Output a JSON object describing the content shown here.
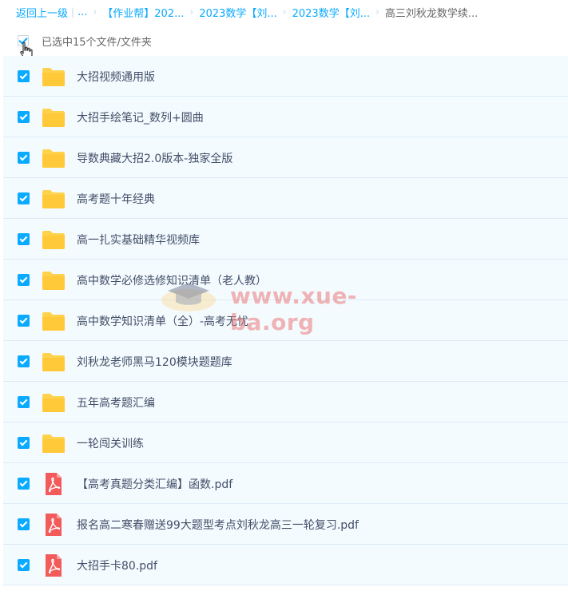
{
  "breadcrumb": {
    "back_label": "返回上一级",
    "ellipsis": "...",
    "crumbs": [
      "【作业帮】202...",
      "2023数学【刘...",
      "2023数学【刘..."
    ],
    "current": "高三刘秋龙数学续..."
  },
  "selection": {
    "label": "已选中15个文件/文件夹"
  },
  "files": [
    {
      "name": "大招视频通用版",
      "icon": "folder-icon",
      "checked": true
    },
    {
      "name": "大招手绘笔记_数列+圆曲",
      "icon": "folder-icon",
      "checked": true
    },
    {
      "name": "导数典藏大招2.0版本-独家全版",
      "icon": "folder-icon",
      "checked": true
    },
    {
      "name": "高考题十年经典",
      "icon": "folder-icon",
      "checked": true
    },
    {
      "name": "高一扎实基础精华视频库",
      "icon": "folder-icon",
      "checked": true
    },
    {
      "name": "高中数学必修选修知识清单（老人教）",
      "icon": "folder-icon",
      "checked": true
    },
    {
      "name": "高中数学知识清单（全）-高考无忧",
      "icon": "folder-icon",
      "checked": true
    },
    {
      "name": "刘秋龙老师黑马120模块题题库",
      "icon": "folder-icon",
      "checked": true
    },
    {
      "name": "五年高考题汇编",
      "icon": "folder-icon",
      "checked": true
    },
    {
      "name": "一轮闯关训练",
      "icon": "folder-icon",
      "checked": true
    },
    {
      "name": "【高考真题分类汇编】函数.pdf",
      "icon": "pdf-icon",
      "checked": true
    },
    {
      "name": "报名高二寒春赠送99大题型考点刘秋龙高三一轮复习.pdf",
      "icon": "pdf-icon",
      "checked": true
    },
    {
      "name": "大招手卡80.pdf",
      "icon": "pdf-icon",
      "checked": true
    }
  ],
  "watermark": {
    "text": "www.xue-ba.org"
  },
  "colors": {
    "accent": "#09aaff",
    "folder": "#ffd24d",
    "pdf": "#f35a5a",
    "row_bg": "#f4fbff"
  }
}
